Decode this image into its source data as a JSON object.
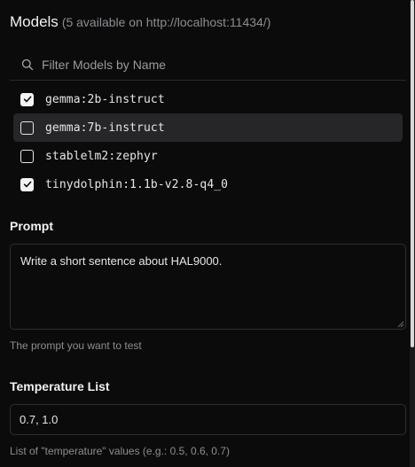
{
  "models": {
    "title": "Models",
    "subtitle": "(5 available on http://localhost:11434/)",
    "filter_placeholder": "Filter Models by Name",
    "items": [
      {
        "label": "gemma:2b-instruct",
        "checked": true
      },
      {
        "label": "gemma:7b-instruct",
        "checked": false,
        "hovered": true
      },
      {
        "label": "stablelm2:zephyr",
        "checked": false
      },
      {
        "label": "tinydolphin:1.1b-v2.8-q4_0",
        "checked": true
      }
    ]
  },
  "prompt": {
    "label": "Prompt",
    "value": "Write a short sentence about HAL9000.",
    "help": "The prompt you want to test"
  },
  "temperature": {
    "label": "Temperature List",
    "value": "0.7, 1.0",
    "help": "List of \"temperature\" values (e.g.: 0.5, 0.6, 0.7)"
  },
  "colors": {
    "background": "#0b0b0c",
    "hover_row": "#262629",
    "muted_text": "#8d8d93",
    "border": "#2e2e31"
  }
}
